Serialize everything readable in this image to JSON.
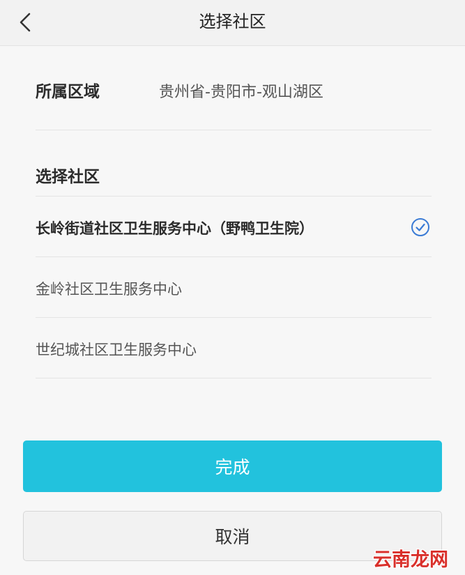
{
  "header": {
    "title": "选择社区",
    "back_icon": "chevron-left-icon"
  },
  "region": {
    "label": "所属区域",
    "value": "贵州省-贵阳市-观山湖区"
  },
  "community_section": {
    "title": "选择社区",
    "items": [
      {
        "label": "长岭街道社区卫生服务中心（野鸭卫生院）",
        "selected": true
      },
      {
        "label": "金岭社区卫生服务中心",
        "selected": false
      },
      {
        "label": "世纪城社区卫生服务中心",
        "selected": false
      }
    ],
    "check_icon": "check-circle-icon"
  },
  "actions": {
    "done_label": "完成",
    "cancel_label": "取消"
  },
  "watermark": {
    "text": "云南龙网"
  },
  "colors": {
    "accent": "#22c2dd",
    "check": "#3a7bd5",
    "watermark": "#d9302b"
  }
}
